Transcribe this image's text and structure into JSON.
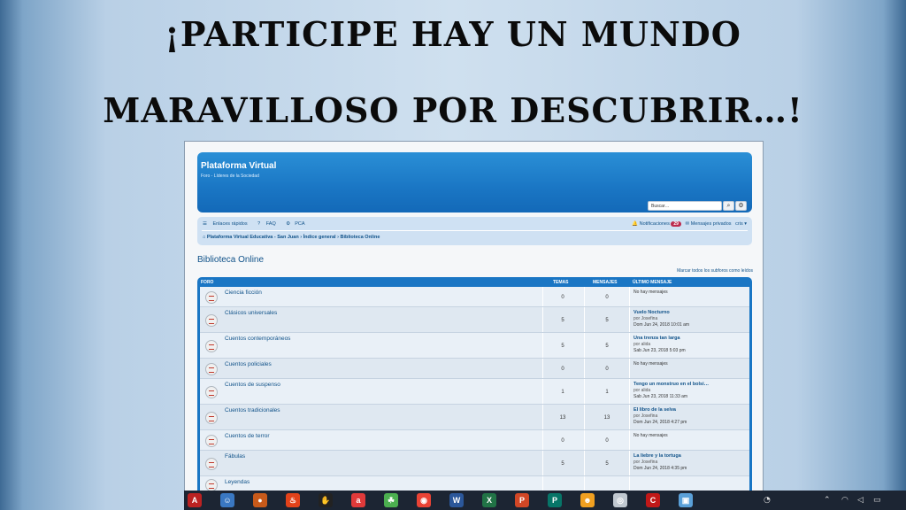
{
  "slide": {
    "title_line1": "¡Participe hay un mundo",
    "title_line2": "maravilloso por descubrir…!"
  },
  "forum": {
    "site_title": "Plataforma Virtual",
    "site_description": "Foro - Líderes de la Sociedad",
    "search_placeholder": "Buscar…",
    "nav": {
      "quick_links": "Enlaces rápidos",
      "faq": "FAQ",
      "pca": "PCA",
      "notifications": "Notificaciones",
      "notifications_count": "29",
      "private_messages": "Mensajes privados",
      "user": "cris"
    },
    "breadcrumbs": [
      "Plataforma Virtual Educativa - San Juan",
      "Índice general",
      "Biblioteca Online"
    ],
    "page_title": "Biblioteca Online",
    "mark_read": "Marcar todos los subforos como leídos",
    "columns": {
      "forum": "FORO",
      "topics": "TEMAS",
      "posts": "MENSAJES",
      "last_post": "ÚLTIMO MENSAJE"
    },
    "rows": [
      {
        "name": "Ciencia ficción",
        "topics": "0",
        "posts": "0",
        "last_title": "",
        "last_by": "",
        "last_date": "No hay mensajes"
      },
      {
        "name": "Clásicos universales",
        "topics": "5",
        "posts": "5",
        "last_title": "Vuelo Nocturno",
        "last_by": "por Josefina",
        "last_date": "Dom Jun 24, 2018 10:01 am"
      },
      {
        "name": "Cuentos contemporáneos",
        "topics": "5",
        "posts": "5",
        "last_title": "Una trenza tan larga",
        "last_by": "por alida",
        "last_date": "Sab Jun 23, 2018 5:03 pm"
      },
      {
        "name": "Cuentos policiales",
        "topics": "0",
        "posts": "0",
        "last_title": "",
        "last_by": "",
        "last_date": "No hay mensajes"
      },
      {
        "name": "Cuentos de suspenso",
        "topics": "1",
        "posts": "1",
        "last_title": "Tengo un monstruo en el bolsi…",
        "last_by": "por alida",
        "last_date": "Sab Jun 23, 2018 11:33 am"
      },
      {
        "name": "Cuentos tradicionales",
        "topics": "13",
        "posts": "13",
        "last_title": "El libro de la selva",
        "last_by": "por Josefina",
        "last_date": "Dom Jun 24, 2018 4:27 pm"
      },
      {
        "name": "Cuentos de terror",
        "topics": "0",
        "posts": "0",
        "last_title": "",
        "last_by": "",
        "last_date": "No hay mensajes"
      },
      {
        "name": "Fábulas",
        "topics": "5",
        "posts": "5",
        "last_title": "La liebre y la tortuga",
        "last_by": "por Josefina",
        "last_date": "Dom Jun 24, 2018 4:35 pm"
      },
      {
        "name": "Leyendas",
        "topics": "",
        "posts": "",
        "last_title": "",
        "last_by": "",
        "last_date": ""
      }
    ]
  },
  "taskbar": {
    "apps": [
      "adobe-reader-icon",
      "finder-icon",
      "basketball-icon",
      "flame-icon",
      "hand-icon",
      "acrobat-icon",
      "frog-icon",
      "chrome-icon",
      "word-icon",
      "excel-icon",
      "powerpoint-icon",
      "publisher-icon",
      "scratch-icon",
      "audacity-icon",
      "camtasia-icon",
      "window-icon"
    ]
  }
}
